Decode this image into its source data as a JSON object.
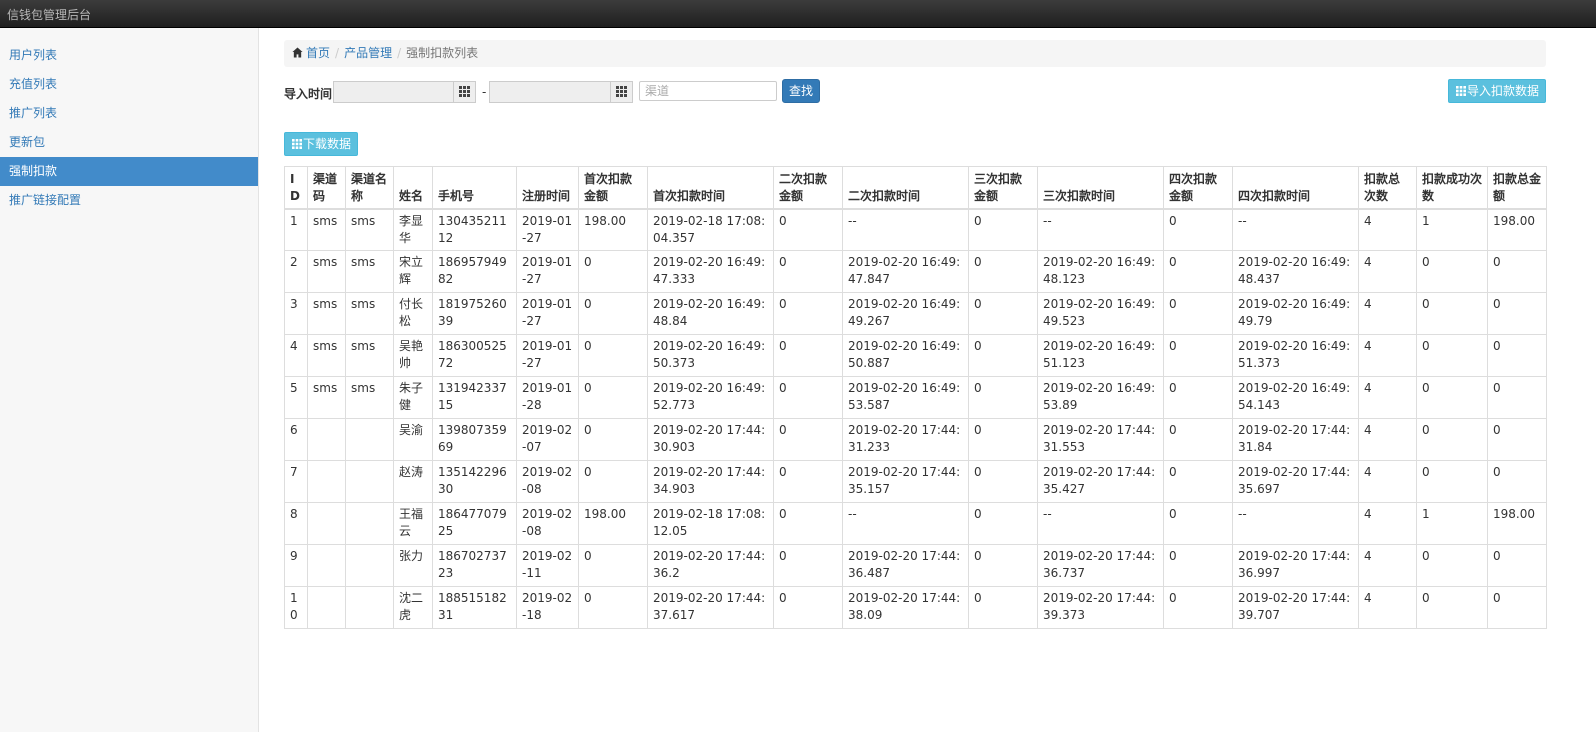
{
  "app": {
    "title": "信钱包管理后台"
  },
  "sidebar": {
    "items": [
      {
        "label": "用户列表"
      },
      {
        "label": "充值列表"
      },
      {
        "label": "推广列表"
      },
      {
        "label": "更新包"
      },
      {
        "label": "强制扣款",
        "active": true
      },
      {
        "label": "推广链接配置"
      }
    ]
  },
  "breadcrumb": {
    "home": "首页",
    "level1": "产品管理",
    "current": "强制扣款列表"
  },
  "filter": {
    "label": "导入时间",
    "start_value": "",
    "dash": "-",
    "end_value": "",
    "channel_placeholder": "渠道",
    "search_label": "查找"
  },
  "actions": {
    "import_label": "导入扣款数据",
    "download_label": "下载数据"
  },
  "colors": {
    "primary": "#337ab7",
    "info": "#5bc0de",
    "active": "#428bca",
    "topbar": "#2b2b2b"
  },
  "icons": {
    "home": "home-icon",
    "grid": "th-icon",
    "calendar": "grid-icon"
  },
  "table": {
    "headers": [
      "ID",
      "渠道码",
      "渠道名称",
      "姓名",
      "手机号",
      "注册时间",
      "首次扣款金额",
      "首次扣款时间",
      "二次扣款金额",
      "二次扣款时间",
      "三次扣款金额",
      "三次扣款时间",
      "四次扣款金额",
      "四次扣款时间",
      "扣款总次数",
      "扣款成功次数",
      "扣款总金额"
    ],
    "rows": [
      [
        "1",
        "sms",
        "sms",
        "李显华",
        "13043521112",
        "2019-01-27",
        "198.00",
        "2019-02-18 17:08:04.357",
        "0",
        "--",
        "0",
        "--",
        "0",
        "--",
        "4",
        "1",
        "198.00"
      ],
      [
        "2",
        "sms",
        "sms",
        "宋立辉",
        "18695794982",
        "2019-01-27",
        "0",
        "2019-02-20 16:49:47.333",
        "0",
        "2019-02-20 16:49:47.847",
        "0",
        "2019-02-20 16:49:48.123",
        "0",
        "2019-02-20 16:49:48.437",
        "4",
        "0",
        "0"
      ],
      [
        "3",
        "sms",
        "sms",
        "付长松",
        "18197526039",
        "2019-01-27",
        "0",
        "2019-02-20 16:49:48.84",
        "0",
        "2019-02-20 16:49:49.267",
        "0",
        "2019-02-20 16:49:49.523",
        "0",
        "2019-02-20 16:49:49.79",
        "4",
        "0",
        "0"
      ],
      [
        "4",
        "sms",
        "sms",
        "吴艳帅",
        "18630052572",
        "2019-01-27",
        "0",
        "2019-02-20 16:49:50.373",
        "0",
        "2019-02-20 16:49:50.887",
        "0",
        "2019-02-20 16:49:51.123",
        "0",
        "2019-02-20 16:49:51.373",
        "4",
        "0",
        "0"
      ],
      [
        "5",
        "sms",
        "sms",
        "朱子健",
        "13194233715",
        "2019-01-28",
        "0",
        "2019-02-20 16:49:52.773",
        "0",
        "2019-02-20 16:49:53.587",
        "0",
        "2019-02-20 16:49:53.89",
        "0",
        "2019-02-20 16:49:54.143",
        "4",
        "0",
        "0"
      ],
      [
        "6",
        "",
        "",
        "吴渝",
        "13980735969",
        "2019-02-07",
        "0",
        "2019-02-20 17:44:30.903",
        "0",
        "2019-02-20 17:44:31.233",
        "0",
        "2019-02-20 17:44:31.553",
        "0",
        "2019-02-20 17:44:31.84",
        "4",
        "0",
        "0"
      ],
      [
        "7",
        "",
        "",
        "赵涛",
        "13514229630",
        "2019-02-08",
        "0",
        "2019-02-20 17:44:34.903",
        "0",
        "2019-02-20 17:44:35.157",
        "0",
        "2019-02-20 17:44:35.427",
        "0",
        "2019-02-20 17:44:35.697",
        "4",
        "0",
        "0"
      ],
      [
        "8",
        "",
        "",
        "王福云",
        "18647707925",
        "2019-02-08",
        "198.00",
        "2019-02-18 17:08:12.05",
        "0",
        "--",
        "0",
        "--",
        "0",
        "--",
        "4",
        "1",
        "198.00"
      ],
      [
        "9",
        "",
        "",
        "张力",
        "18670273723",
        "2019-02-11",
        "0",
        "2019-02-20 17:44:36.2",
        "0",
        "2019-02-20 17:44:36.487",
        "0",
        "2019-02-20 17:44:36.737",
        "0",
        "2019-02-20 17:44:36.997",
        "4",
        "0",
        "0"
      ],
      [
        "10",
        "",
        "",
        "沈二虎",
        "18851518231",
        "2019-02-18",
        "0",
        "2019-02-20 17:44:37.617",
        "0",
        "2019-02-20 17:44:38.09",
        "0",
        "2019-02-20 17:44:39.373",
        "0",
        "2019-02-20 17:44:39.707",
        "4",
        "0",
        "0"
      ]
    ]
  }
}
